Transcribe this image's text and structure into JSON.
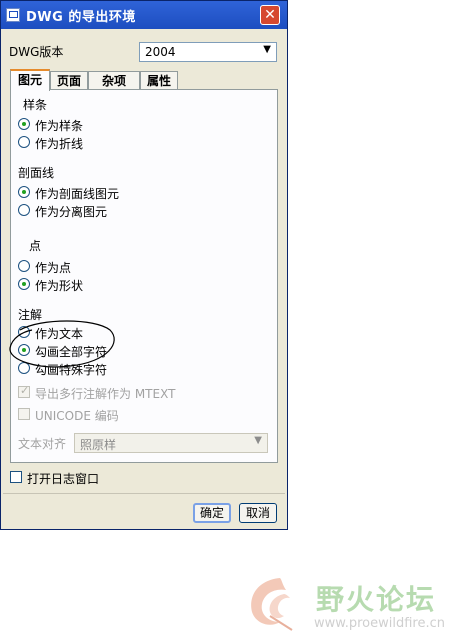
{
  "window": {
    "title": "DWG 的导出环境",
    "close_symbol": "✕"
  },
  "version": {
    "label": "DWG版本",
    "value": "2004"
  },
  "tabs": [
    {
      "label": "图元",
      "active": true
    },
    {
      "label": "页面",
      "active": false
    },
    {
      "label": "杂项",
      "active": false
    },
    {
      "label": "属性",
      "active": false
    }
  ],
  "spline": {
    "heading": "样条",
    "options": [
      "作为样条",
      "作为折线"
    ],
    "selected": 0
  },
  "hatch": {
    "heading": "剖面线",
    "options": [
      "作为剖面线图元",
      "作为分离图元"
    ],
    "selected": 0
  },
  "point": {
    "heading": "点",
    "options": [
      "作为点",
      "作为形状"
    ],
    "selected": 1
  },
  "notes": {
    "heading": "注解",
    "options": [
      "作为文本",
      "勾画全部字符",
      "勾画特殊字符"
    ],
    "selected": 1,
    "mtext_label": "导出多行注解作为 MTEXT",
    "mtext_checked": true,
    "unicode_label": "UNICODE 编码",
    "unicode_checked": false,
    "align_label": "文本对齐",
    "align_value": "照原样"
  },
  "log_window": {
    "label": "打开日志窗口",
    "checked": false
  },
  "buttons": {
    "ok": "确定",
    "cancel": "取消"
  },
  "watermark": {
    "name": "野火论坛",
    "url": "www.proewildfire.cn"
  },
  "colors": {
    "titlebar": "#1d4ec0",
    "dialog_bg": "#ece9d8",
    "radio_dot": "#21a121",
    "tab_highlight": "#e68b2c"
  }
}
